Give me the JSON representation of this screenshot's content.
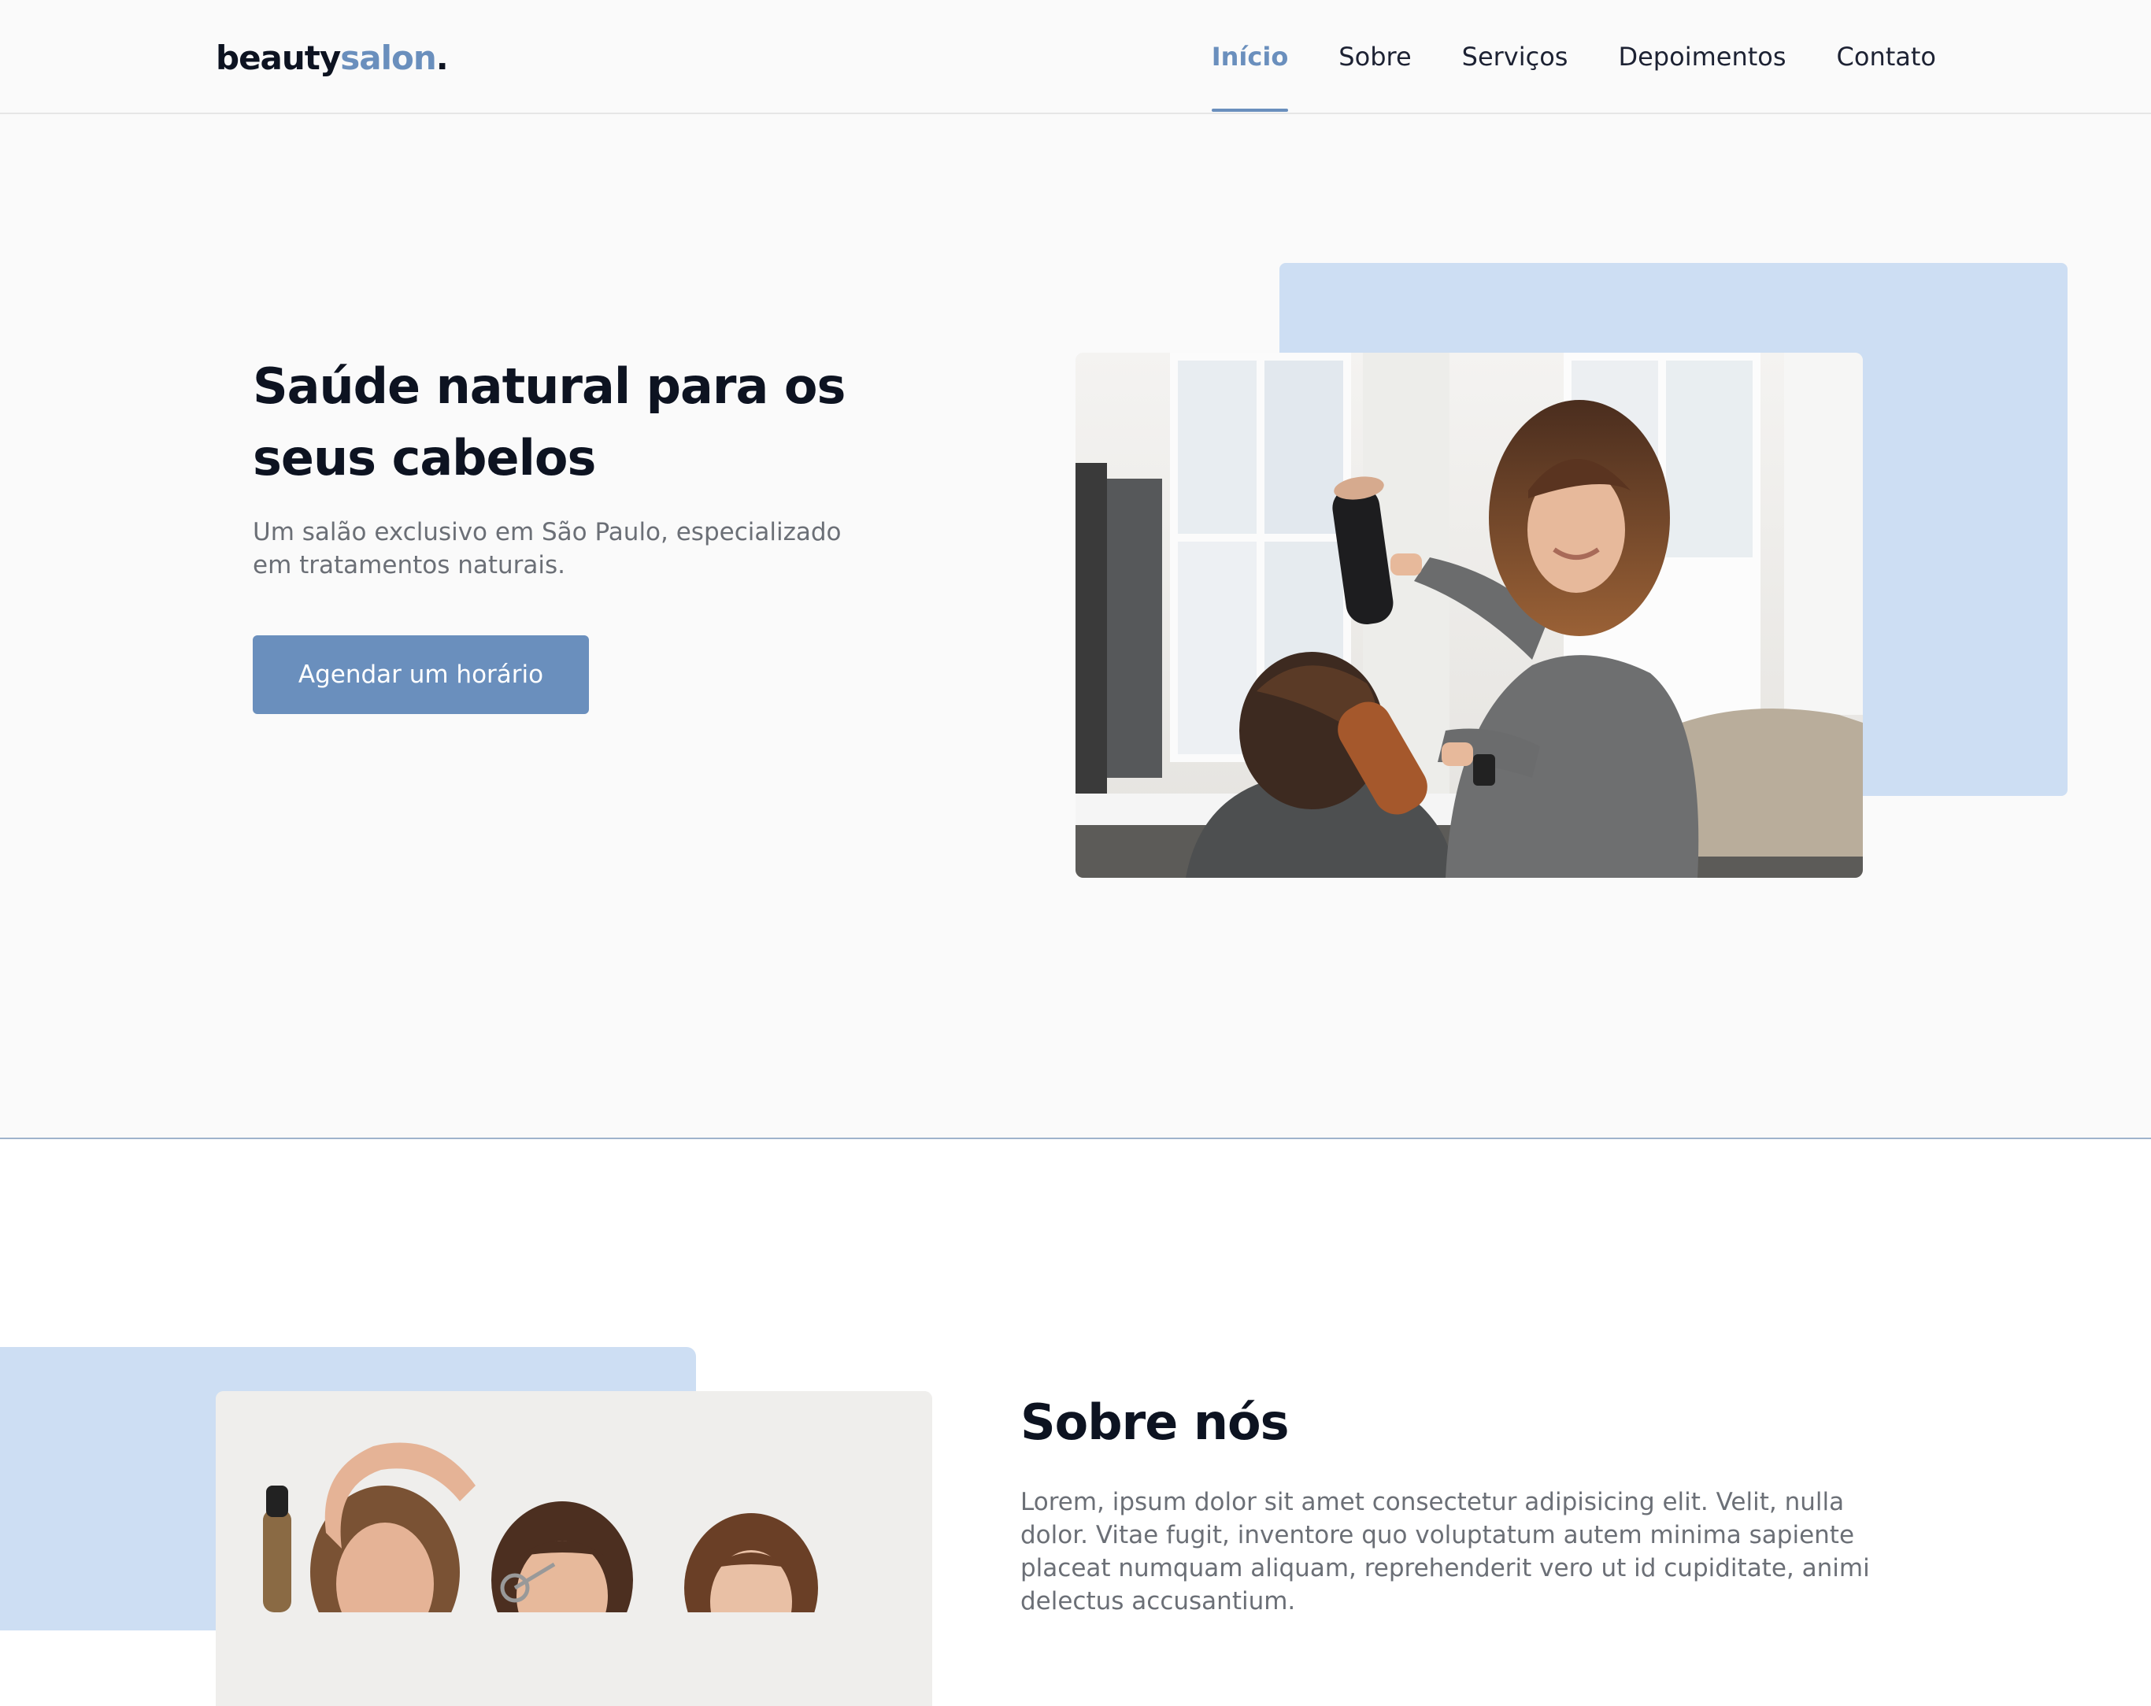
{
  "brand": {
    "name_primary": "beauty",
    "name_accent": "salon",
    "name_suffix": "."
  },
  "nav": {
    "items": [
      {
        "label": "Início",
        "active": true
      },
      {
        "label": "Sobre"
      },
      {
        "label": "Serviços"
      },
      {
        "label": "Depoimentos"
      },
      {
        "label": "Contato"
      }
    ]
  },
  "hero": {
    "title": "Saúde natural para os seus cabelos",
    "subtitle": "Um salão exclusivo em São Paulo, especializado em tratamentos naturais.",
    "cta_label": "Agendar um horário"
  },
  "about": {
    "title": "Sobre nós",
    "text": "Lorem, ipsum dolor sit amet consectetur adipisicing elit. Velit, nulla dolor. Vitae fugit, inventore quo voluptatum autem minima sapiente placeat numquam aliquam, reprehenderit vero ut id cupiditate, animi delectus accusantium."
  },
  "colors": {
    "accent": "#6a8fbd",
    "backdrop": "#cddef3",
    "heading": "#0d1321",
    "body_text": "#6b6f76"
  }
}
